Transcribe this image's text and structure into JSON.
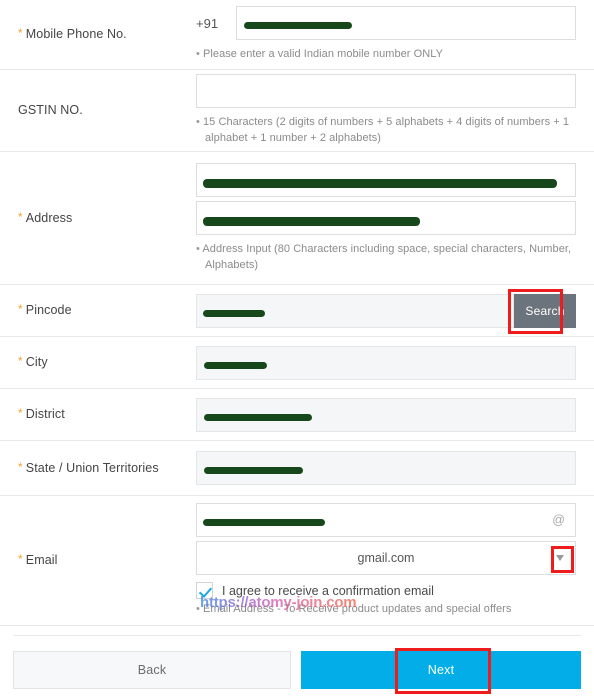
{
  "theme": {
    "required_asterisk_color": "#f5a23c",
    "search_button_color": "#6b737c",
    "next_button_color": "#03aee8",
    "highlight_box_color": "#ee1c1c",
    "redaction_color": "#17481c",
    "checkbox_check_color": "#19a9e8"
  },
  "rows": {
    "mobile": {
      "label": "Mobile Phone No.",
      "required": true,
      "prefix": "+91",
      "value": "",
      "placeholder": "",
      "helper": "Please enter a valid Indian mobile number ONLY"
    },
    "gstin": {
      "label": "GSTIN NO.",
      "required": false,
      "value": "",
      "placeholder": "",
      "helper": "15 Characters (2 digits of numbers + 5 alphabets + 4 digits of numbers + 1 alphabet + 1 number + 2 alphabets)"
    },
    "address": {
      "label": "Address",
      "required": true,
      "line1_value": "",
      "line2_value": "",
      "helper": "Address Input (80 Characters including space, special characters, Number, Alphabets)"
    },
    "pincode": {
      "label": "Pincode",
      "required": true,
      "value": "",
      "search_label": "Search"
    },
    "city": {
      "label": "City",
      "required": true,
      "value": "",
      "readonly": true
    },
    "district": {
      "label": "District",
      "required": true,
      "value": "",
      "readonly": true
    },
    "state": {
      "label": "State / Union Territories",
      "required": true,
      "value": "",
      "readonly": true
    },
    "email": {
      "label": "Email",
      "required": true,
      "username_value": "",
      "at_symbol": "@",
      "domain_selected": "gmail.com",
      "domain_options": [
        "gmail.com"
      ],
      "agree_label": "I agree to receive a confirmation email",
      "agree_checked": true,
      "helper": "Email Address - To Receive product updates and special offers"
    }
  },
  "footer": {
    "back_label": "Back",
    "next_label": "Next"
  },
  "watermark": {
    "text": "https://atomy-join.com"
  }
}
